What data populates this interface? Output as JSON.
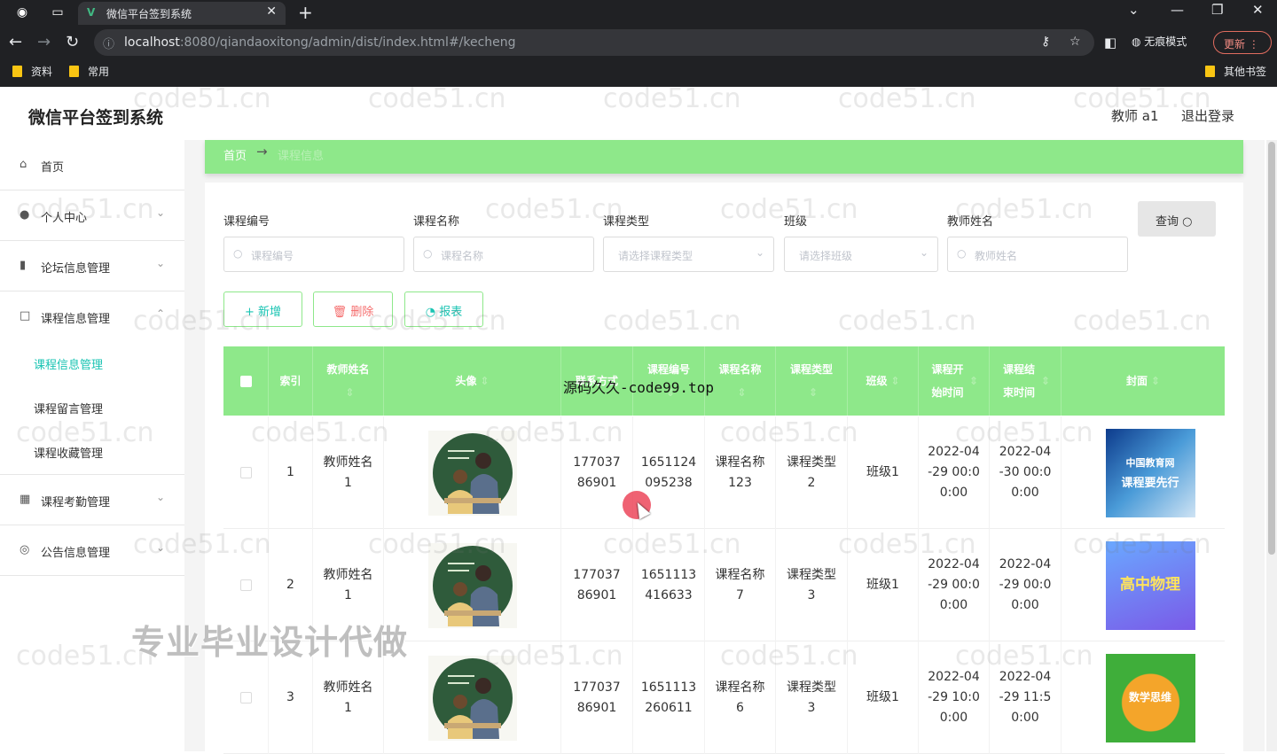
{
  "browser": {
    "tab_title": "微信平台签到系统",
    "url_host": "localhost",
    "url_rest": ":8080/qiandaoxitong/admin/dist/index.html#/kecheng",
    "incognito_label": "无痕模式",
    "update_label": "更新",
    "bookmarks": [
      "资料",
      "常用"
    ],
    "other_bookmarks": "其他书签"
  },
  "header": {
    "brand": "微信平台签到系统",
    "user": "教师 a1",
    "logout": "退出登录"
  },
  "sidebar": {
    "items": [
      {
        "label": "首页",
        "icon": "home-icon"
      },
      {
        "label": "个人中心",
        "icon": "user-icon"
      },
      {
        "label": "论坛信息管理",
        "icon": "chart-icon"
      },
      {
        "label": "课程信息管理",
        "icon": "box-icon"
      },
      {
        "label": "课程考勤管理",
        "icon": "grid-icon"
      },
      {
        "label": "公告信息管理",
        "icon": "globe-icon"
      }
    ],
    "sub_items": [
      "课程信息管理",
      "课程留言管理",
      "课程收藏管理"
    ]
  },
  "breadcrumb": {
    "home": "首页",
    "current": "课程信息"
  },
  "filters": {
    "course_no_label": "课程编号",
    "course_no_placeholder": "课程编号",
    "course_name_label": "课程名称",
    "course_name_placeholder": "课程名称",
    "course_type_label": "课程类型",
    "course_type_placeholder": "请选择课程类型",
    "class_label": "班级",
    "class_placeholder": "请选择班级",
    "teacher_label": "教师姓名",
    "teacher_placeholder": "教师姓名",
    "query_label": "查询"
  },
  "actions": {
    "add": "+ 新增",
    "delete": "删除",
    "report": "报表"
  },
  "table": {
    "headers": {
      "index": "索引",
      "teacher_name": "教师姓名",
      "avatar": "头像",
      "contact": "联系方式",
      "course_no": "课程编号",
      "course_name": "课程名称",
      "course_type": "课程类型",
      "class": "班级",
      "start_time": "课程开始时间",
      "end_time": "课程结束时间",
      "cover": "封面"
    },
    "rows": [
      {
        "index": "1",
        "teacher": "教师姓名1",
        "contact": "17703786901",
        "course_no": "1651124095238",
        "course_name": "课程名称123",
        "course_type": "课程类型2",
        "class": "班级1",
        "start": "2022-04-29 00:00:00",
        "end": "2022-04-30 00:00:00",
        "cover_text": [
          "中国教育网",
          "课程要先行"
        ]
      },
      {
        "index": "2",
        "teacher": "教师姓名1",
        "contact": "17703786901",
        "course_no": "1651113416633",
        "course_name": "课程名称7",
        "course_type": "课程类型3",
        "class": "班级1",
        "start": "2022-04-29 00:00:00",
        "end": "2022-04-29 00:00:00",
        "cover_text": [
          "高中物理",
          ""
        ]
      },
      {
        "index": "3",
        "teacher": "教师姓名1",
        "contact": "17703786901",
        "course_no": "1651113260611",
        "course_name": "课程名称6",
        "course_type": "课程类型3",
        "class": "班级1",
        "start": "2022-04-29 10:00:00",
        "end": "2022-04-29 11:50:00",
        "cover_text": [
          "数学思维",
          ""
        ]
      }
    ]
  },
  "overlays": {
    "mark": "源码久久-code99.top",
    "ad": "专业毕业设计代做",
    "watermark": "code51.cn"
  },
  "colors": {
    "accent": "#8ee88a",
    "teal": "#1ac4b3",
    "danger": "#f56c6c"
  }
}
